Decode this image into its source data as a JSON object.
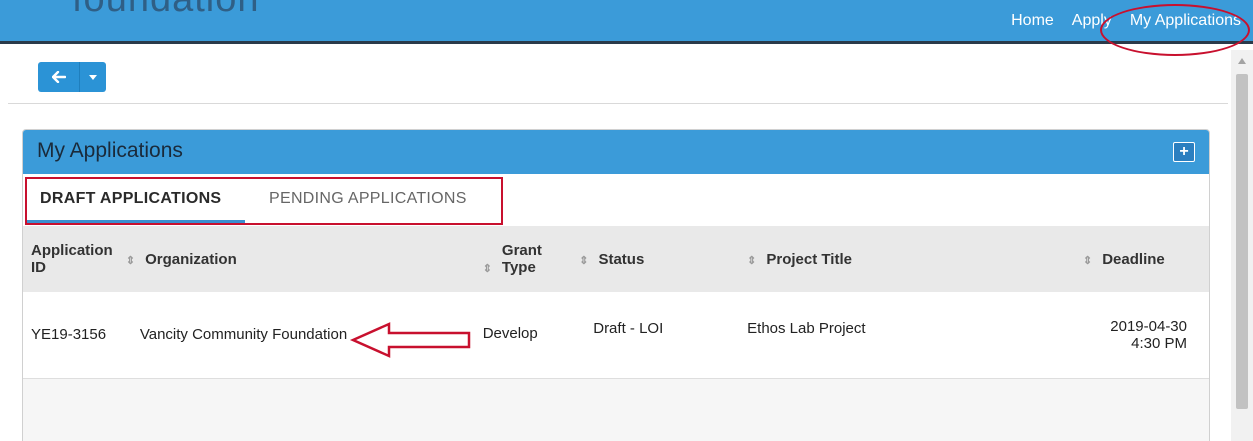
{
  "header": {
    "brand_text": "foundation",
    "nav": [
      "Home",
      "Apply",
      "My Applications"
    ],
    "bar_color": "#3b9bd9"
  },
  "toolbar": {
    "back_icon": "arrow-left-icon",
    "dropdown_icon": "caret-down-icon"
  },
  "panel": {
    "title": "My Applications",
    "add_icon": "plus-icon",
    "tabs": [
      {
        "label": "DRAFT APPLICATIONS",
        "active": true
      },
      {
        "label": "PENDING APPLICATIONS",
        "active": false
      }
    ]
  },
  "table": {
    "columns": [
      "Application ID",
      "Organization",
      "Grant Type",
      "Status",
      "Project Title",
      "Deadline"
    ],
    "rows": [
      {
        "app_id": "YE19-3156",
        "organization": "Vancity Community Foundation",
        "grant_type": "Develop",
        "status": "Draft - LOI",
        "project_title": "Ethos Lab Project",
        "deadline_date": "2019-04-30",
        "deadline_time": "4:30 PM"
      }
    ]
  },
  "annotations": {
    "color": "#c8102e"
  }
}
